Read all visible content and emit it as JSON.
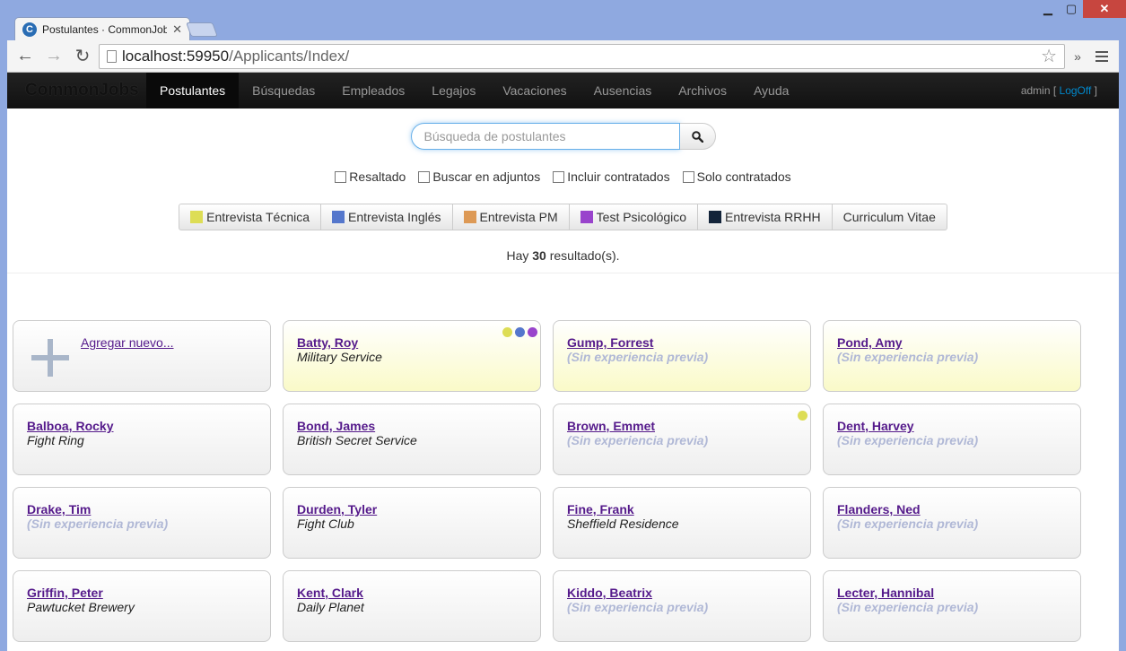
{
  "browser": {
    "tab_title": "Postulantes · CommonJobs",
    "favicon_letter": "C",
    "url_host": "localhost:59950",
    "url_path": "/Applicants/Index/"
  },
  "navbar": {
    "brand": "CommonJobs",
    "items": [
      "Postulantes",
      "Búsquedas",
      "Empleados",
      "Legajos",
      "Vacaciones",
      "Ausencias",
      "Archivos",
      "Ayuda"
    ],
    "user": "admin",
    "logoff": "LogOff"
  },
  "search": {
    "placeholder": "Búsqueda de postulantes"
  },
  "checkboxes": [
    "Resaltado",
    "Buscar en adjuntos",
    "Incluir contratados",
    "Solo contratados"
  ],
  "filters": [
    {
      "label": "Entrevista Técnica",
      "color": "#dddd55"
    },
    {
      "label": "Entrevista Inglés",
      "color": "#5577cc"
    },
    {
      "label": "Entrevista PM",
      "color": "#dd9955"
    },
    {
      "label": "Test Psicológico",
      "color": "#9944cc"
    },
    {
      "label": "Entrevista RRHH",
      "color": "#13243a"
    },
    {
      "label": "Curriculum Vitae",
      "color": null
    }
  ],
  "results": {
    "prefix": "Hay",
    "count": "30",
    "suffix": "resultado(s)."
  },
  "add_new": "Agregar nuevo...",
  "applicants": [
    {
      "name": "Batty, Roy",
      "experience": "Military Service",
      "highlighted": true,
      "dots": [
        "#dddd55",
        "#5577cc",
        "#9944cc"
      ]
    },
    {
      "name": "Gump, Forrest",
      "experience": "(Sin experiencia previa)",
      "highlighted": true,
      "dots": []
    },
    {
      "name": "Pond, Amy",
      "experience": "(Sin experiencia previa)",
      "highlighted": true,
      "dots": []
    },
    {
      "name": "Balboa, Rocky",
      "experience": "Fight Ring",
      "highlighted": false,
      "dots": []
    },
    {
      "name": "Bond, James",
      "experience": "British Secret Service",
      "highlighted": false,
      "dots": []
    },
    {
      "name": "Brown, Emmet",
      "experience": "(Sin experiencia previa)",
      "highlighted": false,
      "dots": [
        "#dddd55"
      ]
    },
    {
      "name": "Dent, Harvey",
      "experience": "(Sin experiencia previa)",
      "highlighted": false,
      "dots": []
    },
    {
      "name": "Drake, Tim",
      "experience": "(Sin experiencia previa)",
      "highlighted": false,
      "dots": []
    },
    {
      "name": "Durden, Tyler",
      "experience": "Fight Club",
      "highlighted": false,
      "dots": []
    },
    {
      "name": "Fine, Frank",
      "experience": "Sheffield Residence",
      "highlighted": false,
      "dots": []
    },
    {
      "name": "Flanders, Ned",
      "experience": "(Sin experiencia previa)",
      "highlighted": false,
      "dots": []
    },
    {
      "name": "Griffin, Peter",
      "experience": "Pawtucket Brewery",
      "highlighted": false,
      "dots": []
    },
    {
      "name": "Kent, Clark",
      "experience": "Daily Planet",
      "highlighted": false,
      "dots": []
    },
    {
      "name": "Kiddo, Beatrix",
      "experience": "(Sin experiencia previa)",
      "highlighted": false,
      "dots": []
    },
    {
      "name": "Lecter, Hannibal",
      "experience": "(Sin experiencia previa)",
      "highlighted": false,
      "dots": []
    }
  ]
}
